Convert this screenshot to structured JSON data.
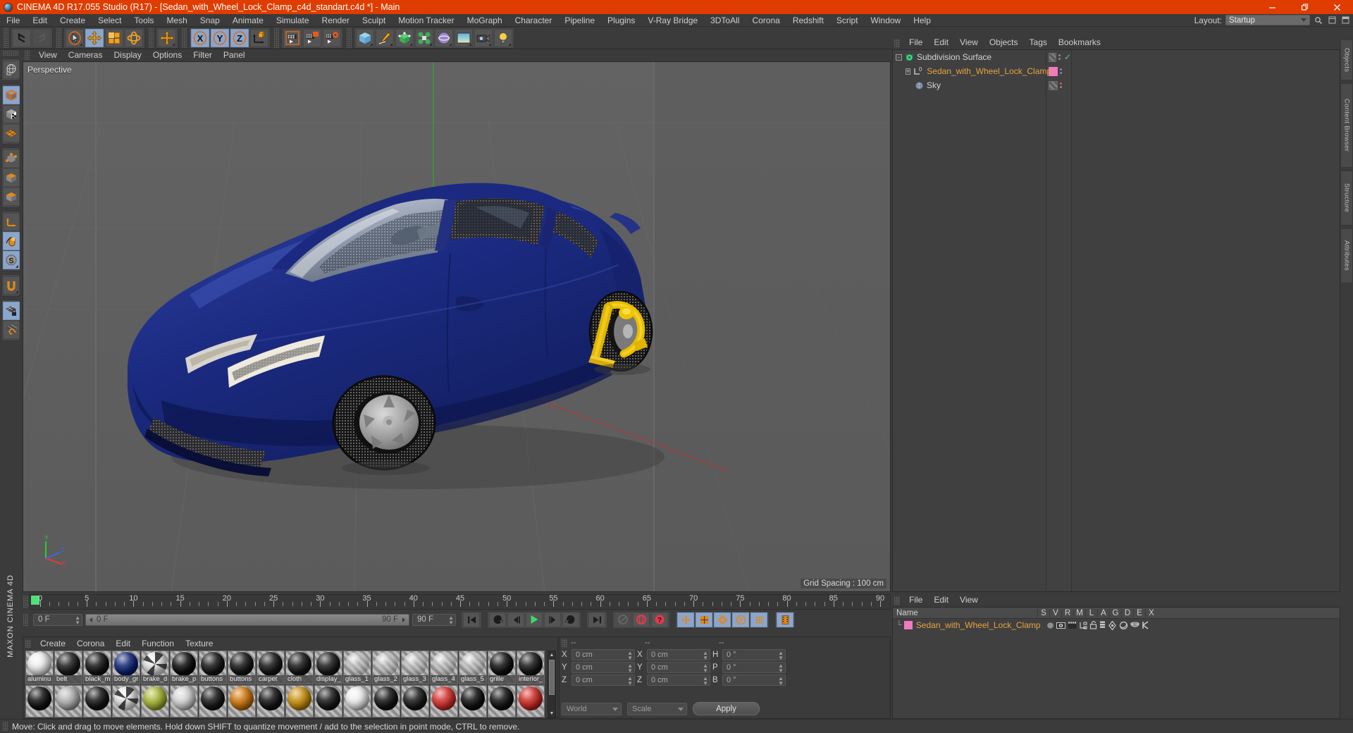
{
  "window": {
    "title": "CINEMA 4D R17.055 Studio (R17) - [Sedan_with_Wheel_Lock_Clamp_c4d_standart.c4d *] - Main",
    "minimize": "minimize-icon",
    "restore": "restore-icon",
    "close": "close-icon"
  },
  "menubar": {
    "items": [
      "File",
      "Edit",
      "Create",
      "Select",
      "Tools",
      "Mesh",
      "Snap",
      "Animate",
      "Simulate",
      "Render",
      "Sculpt",
      "Motion Tracker",
      "MoGraph",
      "Character",
      "Pipeline",
      "Plugins",
      "V-Ray Bridge",
      "3DToAll",
      "Corona",
      "Redshift",
      "Script",
      "Window",
      "Help"
    ],
    "layout_label": "Layout:",
    "layout_value": "Startup",
    "search_icon": "search-icon",
    "minimize_icon": "panel-minimize-icon",
    "maximize_icon": "panel-maximize-icon"
  },
  "toolbar": {
    "groups": [
      {
        "name": "history",
        "buttons": [
          {
            "name": "undo-button",
            "icon": "undo-arrow",
            "state": "normal"
          },
          {
            "name": "redo-button",
            "icon": "redo-arrow",
            "state": "disabled"
          }
        ]
      },
      {
        "name": "transform",
        "buttons": [
          {
            "name": "select-tool",
            "icon": "cursor-circle",
            "state": "normal"
          },
          {
            "name": "move-tool",
            "icon": "four-way-arrow",
            "state": "active"
          },
          {
            "name": "scale-tool",
            "icon": "scale-square",
            "state": "normal"
          },
          {
            "name": "rotate-tool",
            "icon": "rotate-bands",
            "state": "normal"
          }
        ]
      },
      {
        "name": "world-axis",
        "buttons": [
          {
            "name": "move-world-tool",
            "icon": "four-way-arrow",
            "state": "normal"
          }
        ]
      },
      {
        "name": "axis-locks",
        "buttons": [
          {
            "name": "lock-x-axis",
            "icon": "axis-x",
            "state": "active"
          },
          {
            "name": "lock-y-axis",
            "icon": "axis-y",
            "state": "active"
          },
          {
            "name": "lock-z-axis",
            "icon": "axis-z",
            "state": "active"
          },
          {
            "name": "world-object-coord-toggle",
            "icon": "coord-system",
            "state": "normal"
          }
        ]
      },
      {
        "name": "render",
        "buttons": [
          {
            "name": "render-view-button",
            "icon": "clapper-view",
            "state": "normal"
          },
          {
            "name": "render-to-picture-viewer-button",
            "icon": "clapper-picture",
            "state": "normal"
          },
          {
            "name": "render-settings-button",
            "icon": "clapper-gear",
            "state": "normal"
          }
        ]
      },
      {
        "name": "create",
        "buttons": [
          {
            "name": "add-cube-button",
            "icon": "blue-cube",
            "state": "normal"
          },
          {
            "name": "add-spline-button",
            "icon": "pen-nib",
            "state": "normal"
          },
          {
            "name": "add-nurbs-button",
            "icon": "green-cube-points",
            "state": "normal"
          },
          {
            "name": "add-array-button",
            "icon": "green-cluster",
            "state": "normal"
          },
          {
            "name": "add-deformer-button",
            "icon": "purple-sphere",
            "state": "normal"
          },
          {
            "name": "add-environment-button",
            "icon": "gradient-sky",
            "state": "normal"
          },
          {
            "name": "add-camera-button",
            "icon": "camera",
            "state": "normal"
          },
          {
            "name": "add-light-button",
            "icon": "light-bulb",
            "state": "normal"
          }
        ]
      }
    ]
  },
  "left_palette": {
    "groups": [
      [
        {
          "name": "texture-axis-tool",
          "icon": "globe-axis",
          "state": "normal"
        }
      ],
      [
        {
          "name": "model-mode",
          "icon": "orange-cube",
          "state": "active"
        },
        {
          "name": "texture-mode",
          "icon": "checker-cube",
          "state": "normal"
        },
        {
          "name": "workplane-mode",
          "icon": "orange-grid",
          "state": "normal"
        }
      ],
      [
        {
          "name": "points-mode",
          "icon": "cube-points",
          "state": "normal"
        },
        {
          "name": "edges-mode",
          "icon": "cube-edge",
          "state": "normal"
        },
        {
          "name": "polygons-mode",
          "icon": "cube-face",
          "state": "normal"
        }
      ],
      [
        {
          "name": "object-axis-mode",
          "icon": "axis-corner",
          "state": "normal"
        },
        {
          "name": "viewport-solo-mode",
          "icon": "mouse",
          "state": "active"
        },
        {
          "name": "enable-axis-mode",
          "icon": "s-disc",
          "state": "active"
        }
      ],
      [
        {
          "name": "enable-snap",
          "icon": "magnet",
          "state": "normal"
        }
      ],
      [
        {
          "name": "workplane-lock",
          "icon": "grid-lock",
          "state": "active"
        },
        {
          "name": "workplane-align",
          "icon": "grid-rotate",
          "state": "normal"
        }
      ]
    ],
    "brand": "MAXON CINEMA 4D"
  },
  "viewport": {
    "menu": [
      "View",
      "Cameras",
      "Display",
      "Options",
      "Filter",
      "Panel"
    ],
    "label": "Perspective",
    "grid_spacing": "Grid Spacing : 100 cm",
    "axes": {
      "x": "X",
      "y": "Y",
      "z": "Z"
    },
    "nav_icons": [
      "move-camera-icon",
      "dolly-camera-icon",
      "rotate-camera-icon",
      "maximize-viewport-icon"
    ],
    "colors": {
      "bg": "#606060",
      "floor": "#646464",
      "grid": "#717171",
      "axis_x": "#b03a3a",
      "axis_z": "#3a9f3a",
      "body": "#18277a",
      "body_hi": "#2a3fa8",
      "clamp": "#f2c200"
    }
  },
  "timeline": {
    "ticks": [
      0,
      5,
      10,
      15,
      20,
      25,
      30,
      35,
      40,
      45,
      50,
      55,
      60,
      65,
      70,
      75,
      80,
      85,
      90
    ],
    "current_frame": "0 F",
    "start_field": "0 F",
    "preview_start": "0 F",
    "preview_end": "90 F",
    "end_field": "90 F",
    "controls": [
      {
        "name": "go-to-start-button",
        "icon": "skip-back"
      },
      {
        "name": "previous-keyframe-button",
        "icon": "rewind-key"
      },
      {
        "name": "step-back-button",
        "icon": "step-back"
      },
      {
        "name": "play-button",
        "icon": "play"
      },
      {
        "name": "step-forward-button",
        "icon": "step-forward"
      },
      {
        "name": "next-keyframe-button",
        "icon": "forward-key"
      },
      {
        "name": "go-to-end-button",
        "icon": "skip-forward"
      },
      {
        "name": "record-active-objects-button",
        "icon": "record-dim"
      },
      {
        "name": "autokeying-button",
        "icon": "auto-key-red"
      },
      {
        "name": "keyframe-selection-button",
        "icon": "question-red"
      },
      {
        "name": "position-key-button",
        "icon": "four-way-arrow"
      },
      {
        "name": "scale-key-button",
        "icon": "scale-square"
      },
      {
        "name": "rotation-key-button",
        "icon": "rotate-bands"
      },
      {
        "name": "pla-key-button",
        "icon": "p-circle"
      },
      {
        "name": "parameter-key-button",
        "icon": "dot-matrix"
      },
      {
        "name": "point-level-animation-button",
        "icon": "film-strip"
      }
    ]
  },
  "material_manager": {
    "menu": [
      "Create",
      "Corona",
      "Edit",
      "Function",
      "Texture"
    ],
    "row1": [
      {
        "name": "aluminu",
        "color": "#f2f2f2",
        "kind": "light"
      },
      {
        "name": "belt",
        "color": "#1c1c1c",
        "kind": "dark"
      },
      {
        "name": "black_m",
        "color": "#121212",
        "kind": "dark"
      },
      {
        "name": "body_gr",
        "color": "#0d2276",
        "kind": "blue"
      },
      {
        "name": "brake_d",
        "color": "#dcdcdc",
        "kind": "pattern"
      },
      {
        "name": "brake_p",
        "color": "#0a0a0a",
        "kind": "dark"
      },
      {
        "name": "buttons",
        "color": "#141414",
        "kind": "dark"
      },
      {
        "name": "buttons",
        "color": "#141414",
        "kind": "dark"
      },
      {
        "name": "carpet",
        "color": "#151515",
        "kind": "dark"
      },
      {
        "name": "cloth",
        "color": "#161616",
        "kind": "dark"
      },
      {
        "name": "display_",
        "color": "#1a1a1a",
        "kind": "dark"
      },
      {
        "name": "glass_1",
        "color": "#b9b9b9",
        "kind": "glass"
      },
      {
        "name": "glass_2",
        "color": "#b0b0b0",
        "kind": "glass"
      },
      {
        "name": "glass_3",
        "color": "#bcbcbc",
        "kind": "glass"
      },
      {
        "name": "glass_4",
        "color": "#cfcfcf",
        "kind": "glass"
      },
      {
        "name": "glass_5",
        "color": "#c6c6c6",
        "kind": "glass"
      },
      {
        "name": "grille",
        "color": "#101010",
        "kind": "dark"
      },
      {
        "name": "interior_",
        "color": "#151515",
        "kind": "dark"
      }
    ],
    "row2": [
      {
        "name": "",
        "color": "#101010",
        "kind": "dark"
      },
      {
        "name": "",
        "color": "#b4b4b4",
        "kind": "light"
      },
      {
        "name": "",
        "color": "#141414",
        "kind": "dark"
      },
      {
        "name": "",
        "color": "#e6e6e6",
        "kind": "pattern"
      },
      {
        "name": "",
        "color": "#a8b832",
        "kind": "green"
      },
      {
        "name": "",
        "color": "#d8d8d8",
        "kind": "light"
      },
      {
        "name": "",
        "color": "#161616",
        "kind": "dark"
      },
      {
        "name": "",
        "color": "#d2760a",
        "kind": "orange"
      },
      {
        "name": "",
        "color": "#131313",
        "kind": "dark"
      },
      {
        "name": "",
        "color": "#c9900c",
        "kind": "orange"
      },
      {
        "name": "",
        "color": "#171717",
        "kind": "dark"
      },
      {
        "name": "",
        "color": "#f0f0f0",
        "kind": "light"
      },
      {
        "name": "",
        "color": "#121212",
        "kind": "dark"
      },
      {
        "name": "",
        "color": "#181818",
        "kind": "dark"
      },
      {
        "name": "",
        "color": "#d8302c",
        "kind": "red"
      },
      {
        "name": "",
        "color": "#0e0e0e",
        "kind": "dark"
      },
      {
        "name": "",
        "color": "#101010",
        "kind": "dark"
      },
      {
        "name": "",
        "color": "#d22a24",
        "kind": "red"
      }
    ]
  },
  "coordinates": {
    "headers": [
      "--",
      "--",
      "--"
    ],
    "rows": [
      {
        "pos_label": "X",
        "pos_value": "0 cm",
        "size_label": "X",
        "size_value": "0 cm",
        "rot_label": "H",
        "rot_value": "0 °"
      },
      {
        "pos_label": "Y",
        "pos_value": "0 cm",
        "size_label": "Y",
        "size_value": "0 cm",
        "rot_label": "P",
        "rot_value": "0 °"
      },
      {
        "pos_label": "Z",
        "pos_value": "0 cm",
        "size_label": "Z",
        "size_value": "0 cm",
        "rot_label": "B",
        "rot_value": "0 °"
      }
    ],
    "system": "World",
    "mode": "Scale",
    "apply": "Apply"
  },
  "object_manager": {
    "menu": [
      "File",
      "Edit",
      "View",
      "Objects",
      "Tags",
      "Bookmarks"
    ],
    "items": [
      {
        "label": "Subdivision Surface",
        "icon": "subdivision-surface-icon",
        "indent": 0,
        "expander": "-",
        "tag_color": "none",
        "check": "✓",
        "dot_color": "none"
      },
      {
        "label": "Sedan_with_Wheel_Lock_Clamp",
        "icon": "null-object-icon",
        "indent": 1,
        "expander": "+",
        "tag_color": "#ef7ac0",
        "check": "",
        "dot_color": "none",
        "selected": true
      },
      {
        "label": "Sky",
        "icon": "sky-icon",
        "indent": 1,
        "expander": "",
        "tag_color": "none",
        "check": "",
        "dot_color": "#e05a3a"
      }
    ]
  },
  "attribute_manager": {
    "menu": [
      "File",
      "Edit",
      "View"
    ],
    "columns": [
      "Name",
      "S",
      "V",
      "R",
      "M",
      "L",
      "A",
      "G",
      "D",
      "E",
      "X"
    ],
    "rows": [
      {
        "label": "Sedan_with_Wheel_Lock_Clamp",
        "tag_color": "#ef7ac0",
        "icons": [
          "sphere-gray-icon",
          "eye-icon",
          "clapper-icon",
          "hierarchy-icon",
          "unlock-icon",
          "layers-icon",
          "axis-icon",
          "shade-icon",
          "cap-icon",
          "maxon-k-icon"
        ]
      }
    ]
  },
  "dock_tabs": [
    "Objects",
    "Content Browser",
    "Structure",
    "Attributes"
  ],
  "statusbar": {
    "text": "Move: Click and drag to move elements. Hold down SHIFT to quantize movement / add to the selection in point mode, CTRL to remove."
  }
}
